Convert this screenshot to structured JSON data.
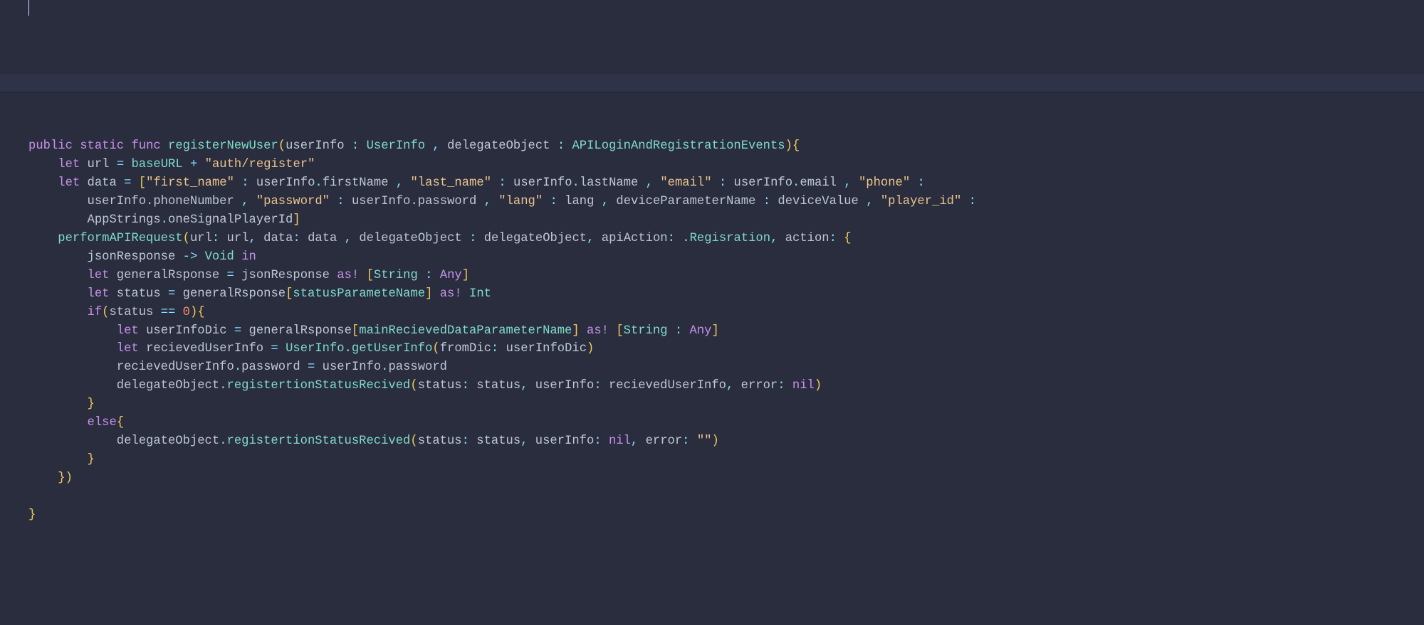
{
  "k": {
    "public": "public",
    "static": "static",
    "func": "func",
    "let": "let",
    "if": "if",
    "else": "else",
    "as": "as!",
    "in": "in",
    "nil": "nil",
    "void": "Void"
  },
  "fn": {
    "registerNewUser": "registerNewUser",
    "performAPIRequest": "performAPIRequest",
    "registertionStatusRecived": "registertionStatusRecived",
    "getUserInfo": "getUserInfo"
  },
  "ty": {
    "UserInfo": "UserInfo",
    "APILoginAndRegistrationEvents": "APILoginAndRegistrationEvents",
    "String": "String",
    "Any": "Any",
    "Int": "Int"
  },
  "id": {
    "userInfo": "userInfo",
    "delegateObject": "delegateObject",
    "url": "url",
    "baseURL": "baseURL",
    "data": "data",
    "firstName": "firstName",
    "lastName": "lastName",
    "email": "email",
    "phoneNumber": "phoneNumber",
    "password": "password",
    "lang": "lang",
    "deviceParameterName": "deviceParameterName",
    "deviceValue": "deviceValue",
    "AppStrings": "AppStrings",
    "oneSignalPlayerId": "oneSignalPlayerId",
    "apiAction": "apiAction",
    "Regisration": "Regisration",
    "action": "action",
    "jsonResponse": "jsonResponse",
    "generalRsponse": "generalRsponse",
    "status": "status",
    "statusParameteName": "statusParameteName",
    "userInfoDic": "userInfoDic",
    "mainRecievedDataParameterName": "mainRecievedDataParameterName",
    "recievedUserInfo": "recievedUserInfo",
    "fromDic": "fromDic",
    "error": "error"
  },
  "s": {
    "authRegister": "\"auth/register\"",
    "first_name": "\"first_name\"",
    "last_name": "\"last_name\"",
    "email": "\"email\"",
    "phone": "\"phone\"",
    "password": "\"password\"",
    "lang": "\"lang\"",
    "player_id": "\"player_id\"",
    "empty": "\"\""
  },
  "n": {
    "zero": "0"
  }
}
